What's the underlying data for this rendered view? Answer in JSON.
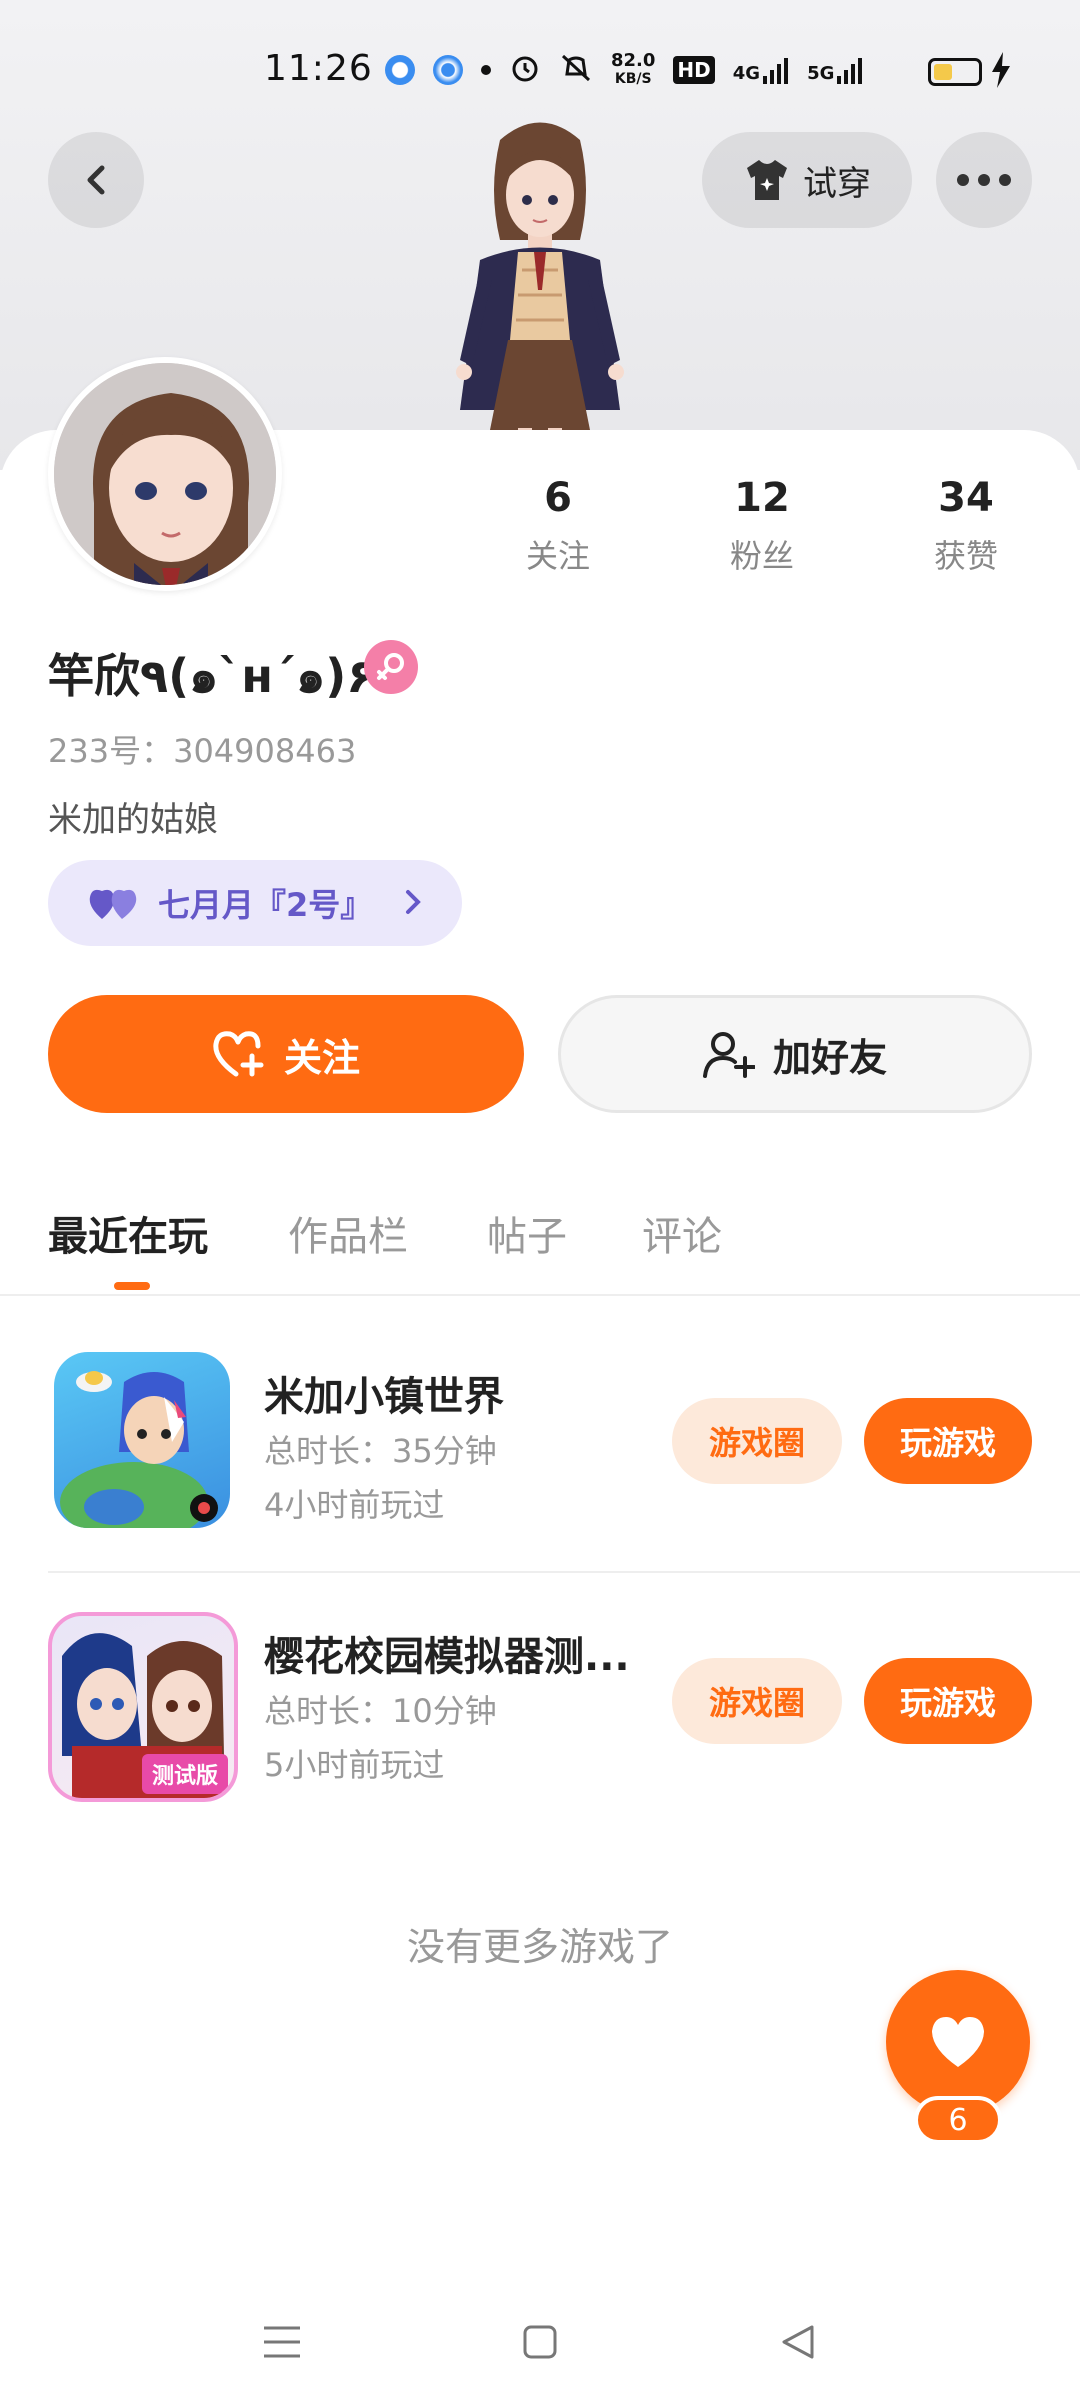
{
  "status_bar": {
    "time": "11:26",
    "net_speed_value": "82.0",
    "net_speed_unit": "KB/S",
    "hd_label": "HD",
    "signal1_label": "4G",
    "signal2_label": "5G"
  },
  "header": {
    "back_icon": "chevron-left-icon",
    "tryon_label": "试穿",
    "more_icon": "more-icon"
  },
  "profile": {
    "username": "竿欣٩(๑`н´๑)۶",
    "gender": "female",
    "uid": "233号：304908463",
    "bio": "米加的姑娘",
    "cp_label": "七月月『2号』",
    "stats": [
      {
        "value": "6",
        "label": "关注"
      },
      {
        "value": "12",
        "label": "粉丝"
      },
      {
        "value": "34",
        "label": "获赞"
      }
    ]
  },
  "actions": {
    "follow_label": "关注",
    "add_friend_label": "加好友"
  },
  "tabs": [
    {
      "label": "最近在玩",
      "active": true
    },
    {
      "label": "作品栏",
      "active": false
    },
    {
      "label": "帖子",
      "active": false
    },
    {
      "label": "评论",
      "active": false
    }
  ],
  "games": [
    {
      "name": "米加小镇世界",
      "duration": "总时长：35分钟",
      "last_played": "4小时前玩过",
      "circle_label": "游戏圈",
      "play_label": "玩游戏"
    },
    {
      "name": "樱花校园模拟器测...",
      "duration": "总时长：10分钟",
      "last_played": "5小时前玩过",
      "circle_label": "游戏圈",
      "play_label": "玩游戏",
      "badge": "测试版"
    }
  ],
  "footer_text": "没有更多游戏了",
  "fab": {
    "icon": "heart-icon",
    "count": "6"
  },
  "colors": {
    "accent": "#ff6b12",
    "accent_light": "#fde9da",
    "cp_bg": "#ebe8fb",
    "cp_text": "#6558c8",
    "gender_pink": "#f47fa8"
  }
}
